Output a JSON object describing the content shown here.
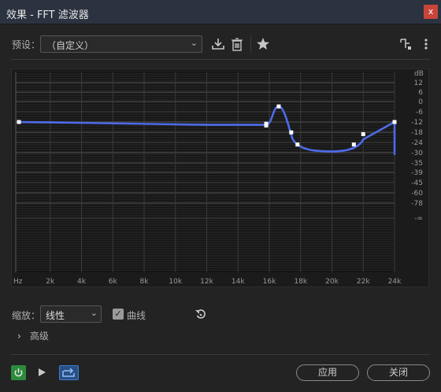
{
  "window": {
    "title": "效果 - FFT 滤波器",
    "close_label": "x"
  },
  "preset": {
    "label": "预设：",
    "value": "（自定义）"
  },
  "toolbar": {
    "download_icon": "download-icon",
    "delete_icon": "trash-icon",
    "favorite_icon": "star-icon",
    "routing_icon": "routing-icon",
    "menu_icon": "kebab-menu-icon"
  },
  "graph": {
    "db_unit": "dB",
    "hz_unit": "Hz",
    "db_ticks": [
      "12",
      "6",
      "0",
      "-6",
      "-12",
      "-18",
      "-24",
      "-30",
      "-35",
      "-39",
      "-48",
      "-60",
      "-78",
      "-∞"
    ],
    "db_ticks_extra": [
      "12",
      "6",
      "0",
      "-6",
      "-12",
      "-18",
      "-24",
      "-30",
      "-35",
      "-39",
      "-45",
      "-60",
      "-78",
      "-∞"
    ],
    "freq_ticks": [
      "2k",
      "4k",
      "6k",
      "8k",
      "10k",
      "12k",
      "14k",
      "16k",
      "18k",
      "20k",
      "22k",
      "24k"
    ],
    "curve_color": "#4d6ae8",
    "control_points": [
      {
        "freq_hz": 0,
        "db": 0
      },
      {
        "freq_hz": 15800,
        "db": -1
      },
      {
        "freq_hz": 15800,
        "db": -2
      },
      {
        "freq_hz": 16600,
        "db": 9
      },
      {
        "freq_hz": 17400,
        "db": -6
      },
      {
        "freq_hz": 17800,
        "db": -13
      },
      {
        "freq_hz": 21400,
        "db": -13
      },
      {
        "freq_hz": 22000,
        "db": -7
      },
      {
        "freq_hz": 24000,
        "db": 0
      }
    ]
  },
  "zoom": {
    "label": "缩放：",
    "value": "线性"
  },
  "curve_toggle": {
    "label": "曲线",
    "checked": true
  },
  "advanced": {
    "label": "高级"
  },
  "footer": {
    "apply_label": "应用",
    "close_label": "关闭"
  }
}
